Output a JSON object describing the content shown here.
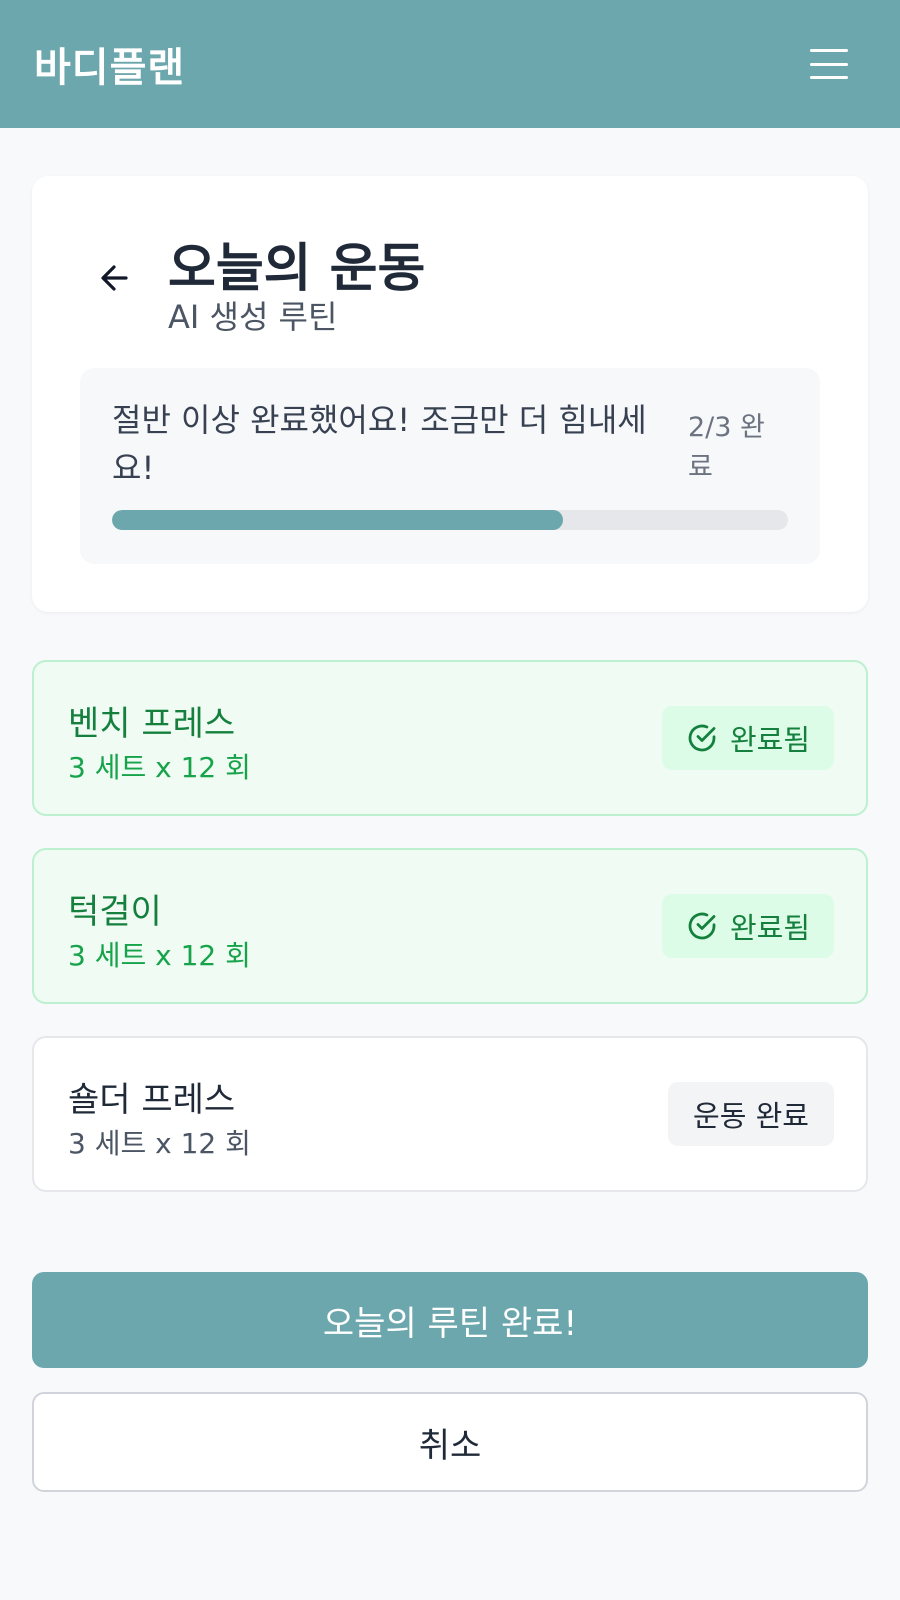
{
  "app": {
    "brand": "바디플랜",
    "menu_icon": "hamburger-menu-icon"
  },
  "header": {
    "title": "오늘의 운동",
    "subtitle": "AI 생성 루틴",
    "back_icon": "arrow-left-icon"
  },
  "progress": {
    "message": "절반 이상 완료했어요! 조금만 더 힘내세요!",
    "count_label": "2/3 완료",
    "completed": 2,
    "total": 3,
    "fraction": 0.667
  },
  "exercises": [
    {
      "name": "벤치 프레스",
      "detail": "3 세트 x 12 회",
      "status": "완료됨",
      "done": true
    },
    {
      "name": "턱걸이",
      "detail": "3 세트 x 12 회",
      "status": "완료됨",
      "done": true
    },
    {
      "name": "숄더 프레스",
      "detail": "3 세트 x 12 회",
      "status": "운동 완료",
      "done": false
    }
  ],
  "actions": {
    "complete_label": "오늘의 루틴 완료!",
    "cancel_label": "취소"
  },
  "colors": {
    "accent": "#6ca7ae",
    "done_bg": "#effbf3",
    "done_text": "#15803d"
  }
}
